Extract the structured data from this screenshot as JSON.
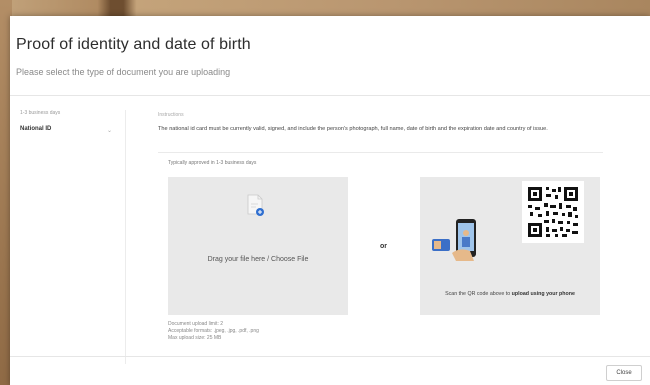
{
  "dialog": {
    "title": "Proof of identity and date of birth",
    "subtitle": "Please select the type of document you are uploading"
  },
  "sidebar": {
    "note": "1-3 business days",
    "items": [
      {
        "label": "National ID",
        "icon": "chevron-down-icon"
      }
    ]
  },
  "instructions": {
    "heading": "Instructions",
    "text": "The national id card must be currently valid, signed, and include the person's photograph, full name, date of birth and the expiration date and country of issue.",
    "typical_note": "Typically approved in 1-3 business days"
  },
  "upload": {
    "drop_label": "Drag your file here / Choose File",
    "or_label": "or",
    "qr_text_prefix": "Scan the QR code above to ",
    "qr_text_strong": "upload using your phone"
  },
  "limits": {
    "line1": "Document upload limit: 2",
    "line2": "Acceptable formats: .jpeg, .jpg, .pdf, .png",
    "line3": "Max upload size: 25 MB"
  },
  "footer": {
    "close_label": "Close"
  },
  "colors": {
    "accent": "#2f6fd0",
    "panel_bg": "#e9e9e9"
  }
}
